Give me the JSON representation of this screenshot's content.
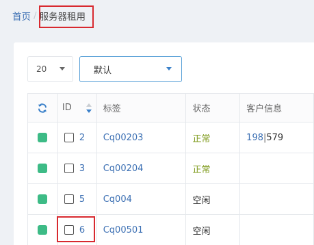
{
  "breadcrumb": {
    "home": "首页",
    "separator": "/",
    "current": "服务器租用"
  },
  "controls": {
    "page_size": {
      "value": "20"
    },
    "sort_select": {
      "value": "默认"
    }
  },
  "table": {
    "headers": {
      "refresh_icon": "refresh-icon",
      "id": "ID",
      "tag": "标签",
      "status": "状态",
      "customer": "客户信息"
    },
    "rows": [
      {
        "id": "2",
        "tag": "Cq00203",
        "status": "正常",
        "customer_a": "198",
        "customer_sep": "|",
        "customer_b": "579"
      },
      {
        "id": "3",
        "tag": "Cq00204",
        "status": "正常",
        "customer_a": "",
        "customer_sep": "",
        "customer_b": ""
      },
      {
        "id": "5",
        "tag": "Cq004",
        "status": "空闲",
        "customer_a": "",
        "customer_sep": "",
        "customer_b": ""
      },
      {
        "id": "6",
        "tag": "Cq00501",
        "status": "空闲",
        "customer_a": "",
        "customer_sep": "",
        "customer_b": ""
      }
    ]
  },
  "colors": {
    "accent": "#3b6fb3",
    "status_green": "#3dbb86",
    "status_ok_text": "#7f9b1d",
    "highlight": "#d8292f"
  }
}
